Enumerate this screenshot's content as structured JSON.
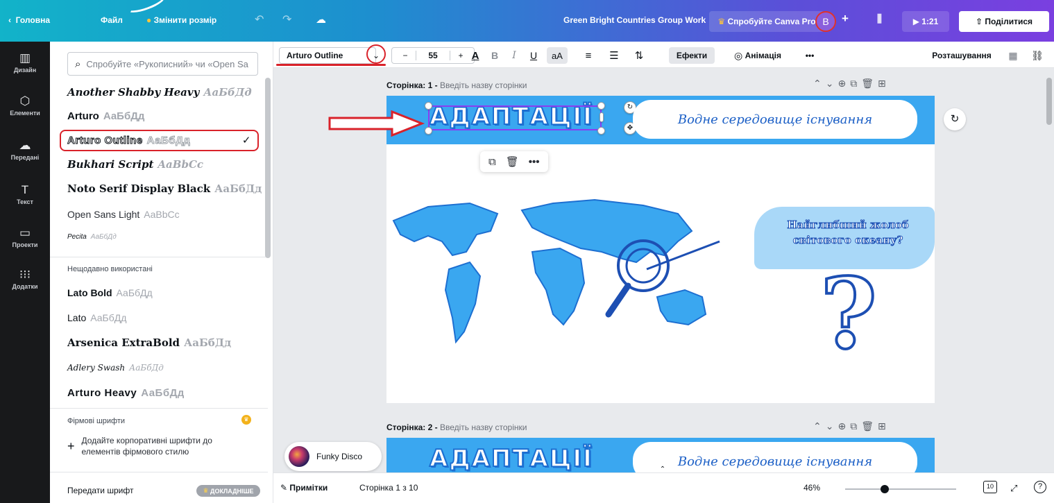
{
  "topbar": {
    "back_label": "Головна",
    "file_label": "Файл",
    "resize_label": "Змінити розмір",
    "doc_title": "Green Bright Countries Group Work",
    "pro_label": "Спробуйте Canva Pro",
    "avatar_letter": "B",
    "add_label": "+",
    "present_time": "1:21",
    "share_label": "Поділитися"
  },
  "rail": {
    "items": [
      {
        "label": "Дизайн",
        "icon": "▥"
      },
      {
        "label": "Елементи",
        "icon": "⬡"
      },
      {
        "label": "Передані",
        "icon": "☁"
      },
      {
        "label": "Текст",
        "icon": "T"
      },
      {
        "label": "Проекти",
        "icon": "▭"
      },
      {
        "label": "Додатки",
        "icon": "⁝⁝⁝"
      }
    ]
  },
  "panel": {
    "search_placeholder": "Спробуйте «Рукописний» чи «Open Sa",
    "fonts": [
      {
        "name": "Another Shabby Heavy",
        "sample": "АаБбДд"
      },
      {
        "name": "Arturo",
        "sample": "АаБбДд"
      },
      {
        "name": "Arturo Outline",
        "sample": "АаБбДд",
        "selected": true
      },
      {
        "name": "Bukhari Script",
        "sample": "AaBbCc"
      },
      {
        "name": "Noto Serif Display Black",
        "sample": "АаБбДд"
      },
      {
        "name": "Open Sans Light",
        "sample": "AaBbCc"
      },
      {
        "name": "Pecita",
        "sample": "АаБбДд"
      }
    ],
    "recent_title": "Нещодавно використані",
    "recent_fonts": [
      {
        "name": "Lato Bold",
        "sample": "АаБбДд"
      },
      {
        "name": "Lato",
        "sample": "АаБбДд"
      },
      {
        "name": "Arsenica ExtraBold",
        "sample": "АаБбДд"
      },
      {
        "name": "Adlery Swash",
        "sample": "АаБбДд"
      },
      {
        "name": "Arturo Heavy",
        "sample": "АаБбДд"
      }
    ],
    "brand_title": "Фірмові шрифти",
    "brand_add_text": "Додайте корпоративні шрифти до елементів фірмового стилю",
    "upload_font_label": "Передати шрифт",
    "more_badge": "ДОКЛАДНІШЕ"
  },
  "toolbar": {
    "font_name": "Arturo Outline",
    "minus": "−",
    "font_size": "55",
    "plus": "+",
    "text_color_glyph": "A",
    "bold_glyph": "B",
    "italic_glyph": "I",
    "underline_glyph": "U",
    "case_glyph": "aA",
    "effects_label": "Ефекти",
    "animation_label": "Анімація",
    "more": "•••",
    "position_label": "Розташування"
  },
  "pages": {
    "page1_label": "Сторінка: 1 -",
    "page1_hint": "Введіть назву сторінки",
    "page2_label": "Сторінка: 2 -",
    "page2_hint": "Введіть назву сторінки"
  },
  "slide": {
    "title": "АДАПТАЦІЇ",
    "pill_text": "Водне середовище існування",
    "question_text": "Найглибший жолоб світового океану?",
    "question_mark": "?"
  },
  "floater": {
    "track_name": "Funky Disco"
  },
  "bottombar": {
    "notes_label": "Примітки",
    "page_counter": "Сторінка 1 з 10",
    "zoom_value": "46%",
    "pages_badge": "10",
    "help_glyph": "?"
  },
  "colors": {
    "banner_blue": "#3aa7f0",
    "title_blue": "#1d6fd1",
    "annotation_red": "#d9222a",
    "selection_purple": "#8b3ef0"
  }
}
